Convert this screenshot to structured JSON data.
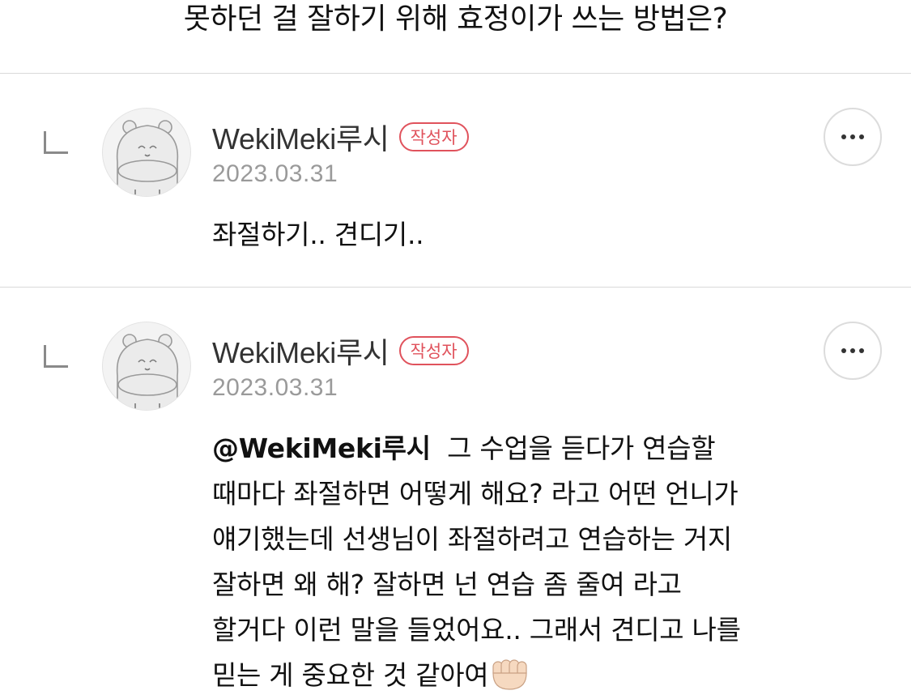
{
  "post": {
    "title": "못하던 걸 잘하기 위해 효정이가 쓰는 방법은?"
  },
  "comments": [
    {
      "author": "WekiMeki루시",
      "badge": "작성자",
      "date": "2023.03.31",
      "lines": [
        "좌절하기.. 견디기.."
      ]
    },
    {
      "author": "WekiMeki루시",
      "badge": "작성자",
      "date": "2023.03.31",
      "mention": "@WekiMeki루시",
      "first_line_rest": "  그 수업을 듣다가 연습할",
      "lines": [
        "때마다 좌절하면 어떻게 해요? 라고 어떤 언니가",
        "얘기했는데 선생님이 좌절하려고 연습하는 거지",
        "잘하면 왜 해? 잘하면 넌 연습 좀 줄여 라고",
        "할거다 이런 말을 들었어요.. 그래서 견디고 나를",
        "믿는 게 중요한 것 같아여"
      ],
      "trailing_icon": "fist-emoji-icon"
    }
  ],
  "colors": {
    "badge": "#e0525c",
    "divider": "#d9d9d9",
    "meta_text": "#9a9a9a"
  }
}
